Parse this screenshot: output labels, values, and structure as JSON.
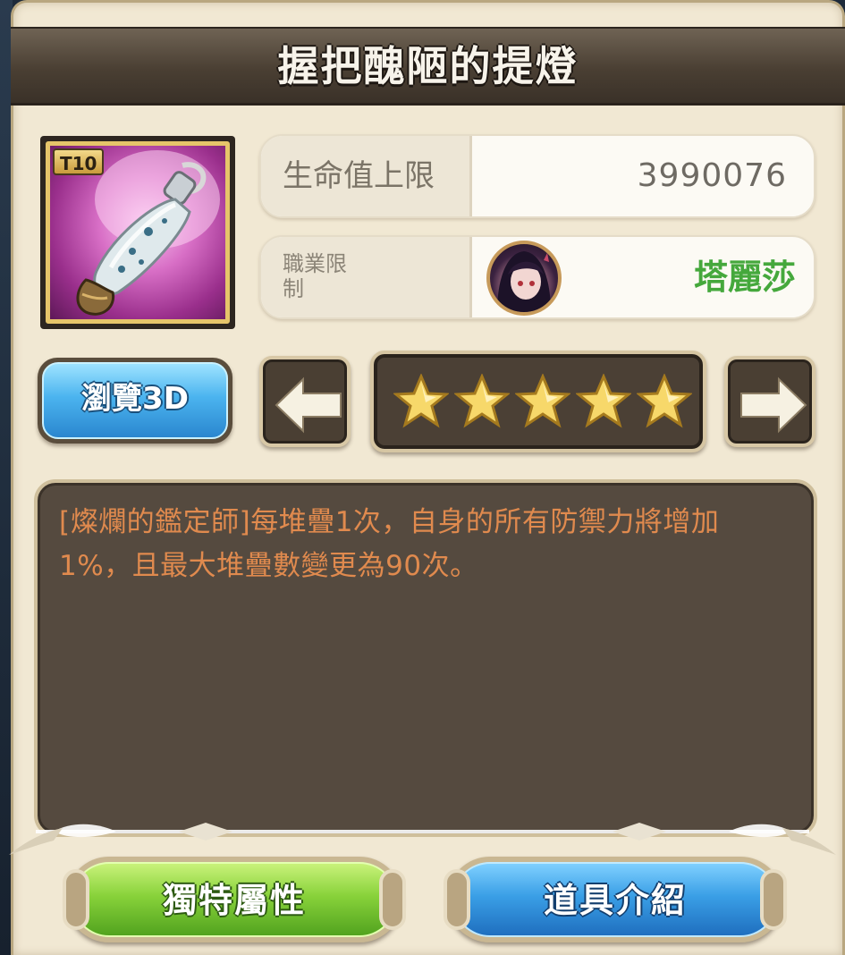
{
  "title": "握把醜陋的提燈",
  "item": {
    "tier": "T10",
    "icon": "lantern-bottle-icon"
  },
  "stats": {
    "hp_label": "生命值上限",
    "hp_value": "3990076",
    "job_label": "職業限制",
    "job_name": "塔麗莎"
  },
  "controls": {
    "view3d_label": "瀏覽3D",
    "stars": 5,
    "prev_icon": "arrow-left-icon",
    "next_icon": "arrow-right-icon"
  },
  "description": "[燦爛的鑑定師]每堆疊1次，自身的所有防禦力將增加1%，且最大堆疊數變更為90次。",
  "buttons": {
    "unique_label": "獨特屬性",
    "intro_label": "道具介紹"
  },
  "colors": {
    "title_bar": "#4a3f33",
    "job_name": "#45a83c",
    "description_text": "#e08a4e",
    "unique_button": "#88d23a",
    "intro_button": "#3a9fe6"
  }
}
